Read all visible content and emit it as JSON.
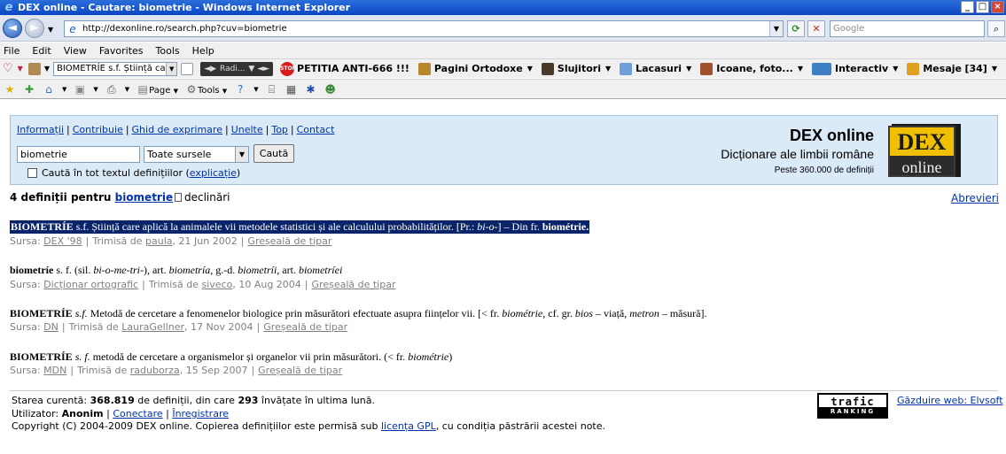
{
  "window": {
    "title": "DEX online - Cautare: biometrie - Windows Internet Explorer",
    "minimize": "_",
    "maximize": "□"
  },
  "address_bar": {
    "url": "http://dexonline.ro/search.php?cuv=biometrie",
    "search_placeholder": "Google"
  },
  "menu": [
    "File",
    "Edit",
    "View",
    "Favorites",
    "Tools",
    "Help"
  ],
  "links_toolbar": {
    "combo_text": "BIOMETRÍE s.f. Știință care aj",
    "player_text": "Radi...",
    "items": [
      {
        "label": "PETITIA ANTI-666 !!!",
        "icon": "stop-sign-icon",
        "color": "#d81d1d"
      },
      {
        "label": "Pagini Ortodoxe",
        "icon": "book-icon",
        "color": "#b8862b"
      },
      {
        "label": "Slujitori",
        "icon": "priest-icon",
        "color": "#4a3a2a"
      },
      {
        "label": "Lacasuri",
        "icon": "church-icon",
        "color": "#6f9fd8"
      },
      {
        "label": "Icoane, foto...",
        "icon": "icon-image-icon",
        "color": "#a0522d"
      },
      {
        "label": "Interactiv",
        "icon": "interactive-icon",
        "color": "#3f7fc6"
      },
      {
        "label": "Mesaje",
        "count": "[34]",
        "icon": "messages-icon",
        "color": "#e0a020"
      }
    ]
  },
  "favorites_toolbar": {
    "page_label": "Page",
    "tools_label": "Tools"
  },
  "page": {
    "top_links": [
      "Informații",
      "Contribuie",
      "Ghid de exprimare",
      "Unelte",
      "Top",
      "Contact"
    ],
    "search_value": "biometrie",
    "source_select": "Toate sursele",
    "search_button": "Caută",
    "fulltext_label": "Caută în tot textul definițiilor",
    "fulltext_link": "explicație",
    "brand_name": "DEX online",
    "brand_tagline": "Dicționare ale limbii române",
    "brand_count": "Peste 360.000 de definiții",
    "logo_top": "DEX",
    "logo_bottom": "online",
    "result_prefix": "4 definiții pentru",
    "result_term": "biometrie",
    "declinari_label": "declinări",
    "abrevieri_link": "Abrevieri"
  },
  "definitions": [
    {
      "html": "<b>BIOMETRÍE</b> s.f. Știință care aplică la animalele vii metodele statistici și ale calculului probabilităților. [Pr.: <i>bi-o-</i>] – Din fr. <b>biométrie.</b>",
      "source": "DEX '98",
      "author": "paula",
      "date": "21 Jun 2002",
      "selected": true
    },
    {
      "html": "<b>biometríe</b> s. f. (sil. <i>bi-o-me-tri-</i>), art. <i>biometría</i>, g.-d. <i>biometríi</i>, art. <i>biometríei</i>",
      "source": "Dicționar ortografic",
      "author": "siveco",
      "date": "10 Aug 2004",
      "selected": false
    },
    {
      "html": "<b>BIOMETRÍE</b> <i>s.f.</i> Metodă de cercetare a fenomenelor biologice prin măsurători efectuate asupra ființelor vii. [&lt; fr. <i>biométrie</i>, cf. gr. <i>bios</i> – viață, <i>metron</i> – măsură].",
      "source": "DN",
      "author": "LauraGellner",
      "date": "17 Nov 2004",
      "selected": false
    },
    {
      "html": "<b>BIOMETRÍE</b> <i>s. f.</i> metodă de cercetare a organismelor și organelor vii prin măsurători. (&lt; fr. <i>biométrie</i>)",
      "source": "MDN",
      "author": "raduborza",
      "date": "15 Sep 2007",
      "selected": false
    }
  ],
  "source_labels": {
    "sursa": "Sursa:",
    "trimisa": "Trimisă de",
    "typo": "Greșeală de tipar"
  },
  "footer": {
    "status_prefix": "Starea curentă:",
    "def_count": "368.819",
    "status_mid": "de definiții, din care",
    "learned": "293",
    "status_suffix": "învățate în ultima lună.",
    "user_prefix": "Utilizator:",
    "user_name": "Anonim",
    "login": "Conectare",
    "register": "Înregistrare",
    "copyright_text": "Copyright (C) 2004-2009 DEX online. Copierea definițiilor este permisă sub",
    "license_link": "licența GPL",
    "copyright_suffix": ", cu condiția păstrării acestei note.",
    "trafic_top": "trafic",
    "trafic_bottom": "RANKING",
    "hosting_link": "Găzduire web: Elvsoft"
  }
}
